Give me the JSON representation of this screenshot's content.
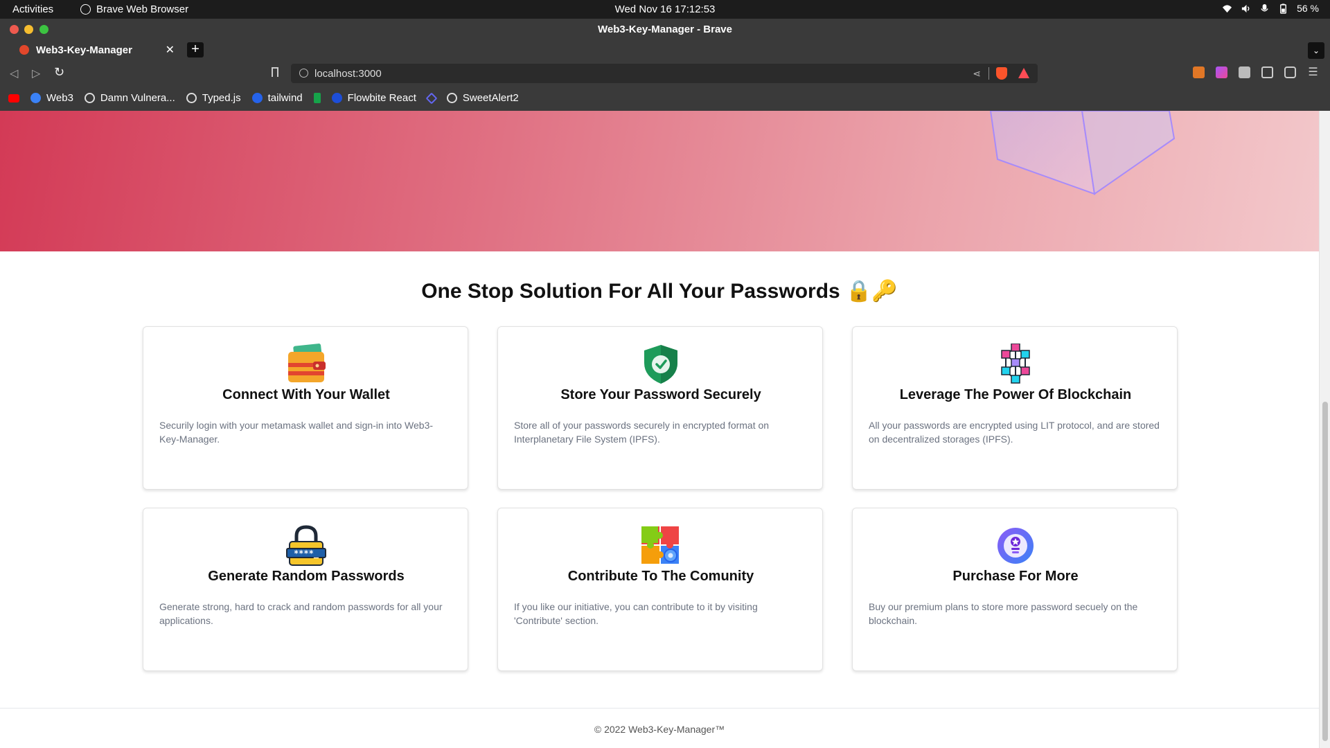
{
  "system_bar": {
    "activities": "Activities",
    "app_name": "Brave Web Browser",
    "datetime": "Wed Nov 16  17:12:53",
    "battery": "56 %"
  },
  "window": {
    "title": "Web3-Key-Manager - Brave"
  },
  "tabs": [
    {
      "label": "Web3-Key-Manager"
    }
  ],
  "toolbar": {
    "url": "localhost:3000"
  },
  "bookmarks": [
    {
      "label": "",
      "icon": "youtube-icon",
      "color": "#ff0000"
    },
    {
      "label": "Web3",
      "icon": "web3-icon",
      "color": "#3b82f6"
    },
    {
      "label": "Damn Vulnera...",
      "icon": "globe-icon",
      "color": "#dddddd"
    },
    {
      "label": "Typed.js",
      "icon": "globe-icon",
      "color": "#dddddd"
    },
    {
      "label": "tailwind",
      "icon": "tailwind-icon",
      "color": "#2563eb"
    },
    {
      "label": "",
      "icon": "dollar-icon",
      "color": "#22c55e"
    },
    {
      "label": "Flowbite React",
      "icon": "flowbite-icon",
      "color": "#1d4ed8"
    },
    {
      "label": "",
      "icon": "diamond-icon",
      "color": "#6366f1"
    },
    {
      "label": "SweetAlert2",
      "icon": "globe-icon",
      "color": "#dddddd"
    }
  ],
  "main": {
    "headline": "One Stop Solution For All Your Passwords 🔒🔑",
    "cards": [
      {
        "title": "Connect With Your Wallet",
        "text": "Securily login with your metamask wallet and sign-in into Web3-Key-Manager.",
        "icon": "wallet-icon"
      },
      {
        "title": "Store Your Password Securely",
        "text": "Store all of your passwords securely in encrypted format on Interplanetary File System (IPFS).",
        "icon": "shield-check-icon"
      },
      {
        "title": "Leverage The Power Of Blockchain",
        "text": "All your passwords are encrypted using LIT protocol, and are stored on decentralized storages (IPFS).",
        "icon": "blockchain-icon"
      },
      {
        "title": "Generate Random Passwords",
        "text": "Generate strong, hard to crack and random passwords for all your applications.",
        "icon": "padlock-password-icon"
      },
      {
        "title": "Contribute To The Comunity",
        "text": "If you like our initiative, you can contribute to it by visiting 'Contribute' section.",
        "icon": "puzzle-icon"
      },
      {
        "title": "Purchase For More",
        "text": "Buy our premium plans to store more password secuely on the blockchain.",
        "icon": "premium-badge-icon"
      }
    ]
  },
  "footer": {
    "text": "© 2022 Web3-Key-Manager™"
  }
}
